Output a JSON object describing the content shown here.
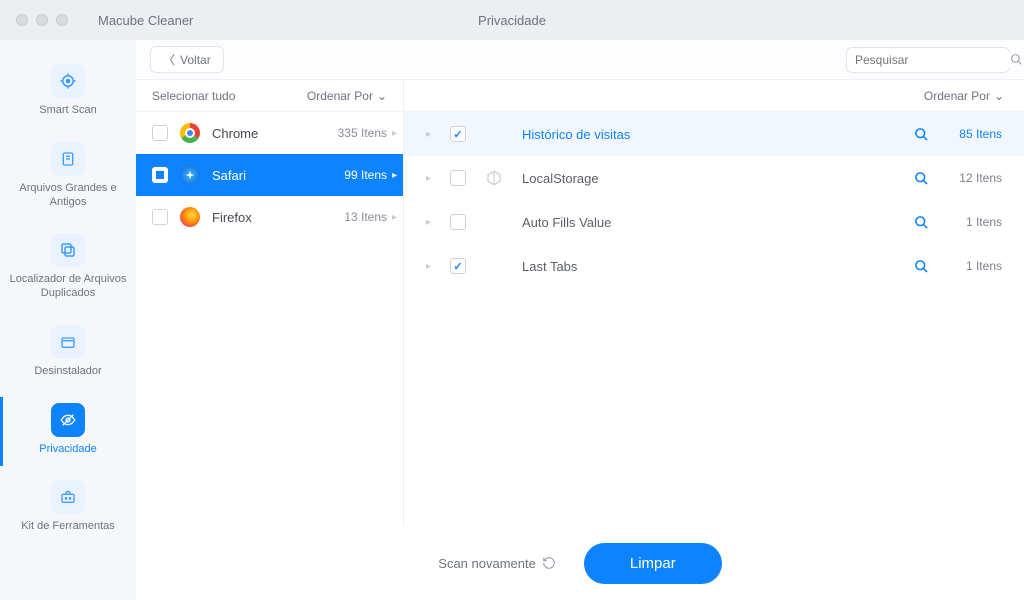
{
  "app_title": "Macube Cleaner",
  "window_title": "Privacidade",
  "back_label": "Voltar",
  "search_placeholder": "Pesquisar",
  "sidebar": [
    {
      "id": "smart-scan",
      "label": "Smart Scan"
    },
    {
      "id": "large-old",
      "label": "Arquivos Grandes e Antigos"
    },
    {
      "id": "duplicates",
      "label": "Localizador de Arquivos Duplicados"
    },
    {
      "id": "uninstaller",
      "label": "Desinstalador"
    },
    {
      "id": "privacy",
      "label": "Privacidade"
    },
    {
      "id": "toolkit",
      "label": "Kit de Ferramentas"
    }
  ],
  "left_header": {
    "select_all": "Selecionar tudo",
    "sort": "Ordenar Por"
  },
  "right_header_sort": "Ordenar Por",
  "browsers": [
    {
      "name": "Chrome",
      "count": "335 Itens"
    },
    {
      "name": "Safari",
      "count": "99 Itens"
    },
    {
      "name": "Firefox",
      "count": "13 Itens"
    }
  ],
  "categories": [
    {
      "name": "Histórico de visitas",
      "count": "85 Itens",
      "checked": true,
      "highlight": true
    },
    {
      "name": "LocalStorage",
      "count": "12 Itens",
      "checked": false,
      "highlight": false
    },
    {
      "name": "Auto Fills Value",
      "count": "1 Itens",
      "checked": false,
      "highlight": false
    },
    {
      "name": "Last Tabs",
      "count": "1 Itens",
      "checked": true,
      "highlight": false
    }
  ],
  "rescan_label": "Scan novamente",
  "clean_label": "Limpar"
}
